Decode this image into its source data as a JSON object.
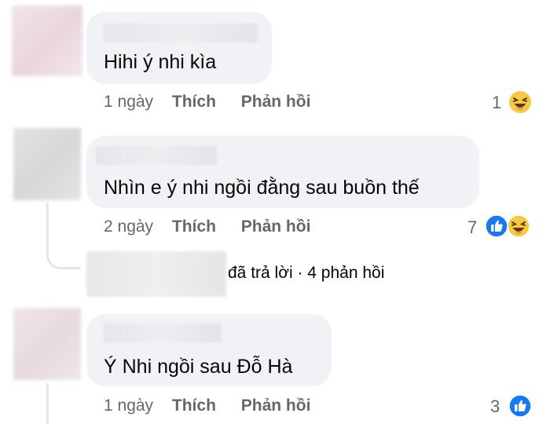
{
  "comments": [
    {
      "text": "Hihi ý nhi kìa",
      "time": "1 ngày",
      "like_label": "Thích",
      "reply_label": "Phản hồi",
      "reaction_count": "1",
      "reactions": [
        "haha-emoji"
      ]
    },
    {
      "text": "Nhìn e ý nhi ngồi đằng sau buồn thế",
      "time": "2 ngày",
      "like_label": "Thích",
      "reply_label": "Phản hồi",
      "reaction_count": "7",
      "reactions": [
        "like-emoji",
        "haha-emoji"
      ],
      "replies_summary": "đã trả lời · 4 phản hồi"
    },
    {
      "text": "Ý Nhi ngồi sau Đỗ Hà",
      "time": "1 ngày",
      "like_label": "Thích",
      "reply_label": "Phản hồi",
      "reaction_count": "3",
      "reactions": [
        "like-emoji"
      ]
    }
  ],
  "colors": {
    "bubble": "#f0f2f5",
    "meta_text": "#65676b",
    "like_blue": "#1877f2",
    "haha_yellow": "#f7c844"
  }
}
